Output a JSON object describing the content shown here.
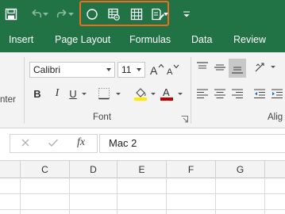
{
  "colors": {
    "excel_green": "#217346",
    "highlight": "#ee6c1c",
    "fill_yellow": "#ffeb00",
    "font_red": "#c00000"
  },
  "quick_access": {
    "icons": [
      "save-icon",
      "undo-icon",
      "redo-icon",
      "circle-shape-icon",
      "record-macro-icon",
      "table-icon",
      "form-icon",
      "customize-toolbar-icon"
    ]
  },
  "tabs": [
    "Insert",
    "Page Layout",
    "Formulas",
    "Data",
    "Review"
  ],
  "ribbon": {
    "clipboard_partial_label": "nter",
    "font": {
      "name": "Calibri",
      "size": "11",
      "bold": "B",
      "italic": "I",
      "underline": "U",
      "group_label": "Font"
    },
    "alignment_partial_label": "Alig"
  },
  "formula_bar": {
    "fx_label": "fx",
    "value": "Mac 2"
  },
  "columns": [
    "C",
    "D",
    "E",
    "F",
    "G"
  ]
}
